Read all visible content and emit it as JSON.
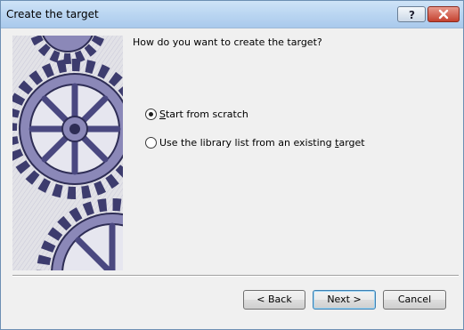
{
  "window": {
    "title": "Create the target"
  },
  "titlebar_buttons": {
    "help_icon": "question-mark-icon",
    "close_icon": "close-icon"
  },
  "content": {
    "question": "How do you want to create the target?",
    "options": [
      {
        "label": "Start from scratch",
        "underline_char": "S",
        "selected": true
      },
      {
        "label": "Use the library list from an existing target",
        "underline_char": "t",
        "selected": false
      }
    ]
  },
  "buttons": {
    "back": "< Back",
    "next": "Next >",
    "cancel": "Cancel"
  },
  "colors": {
    "title_gradient_top": "#cfe3f7",
    "close_red": "#c4412f",
    "gear_ink": "#3d3c6e",
    "gear_wash": "#8b88b8"
  }
}
